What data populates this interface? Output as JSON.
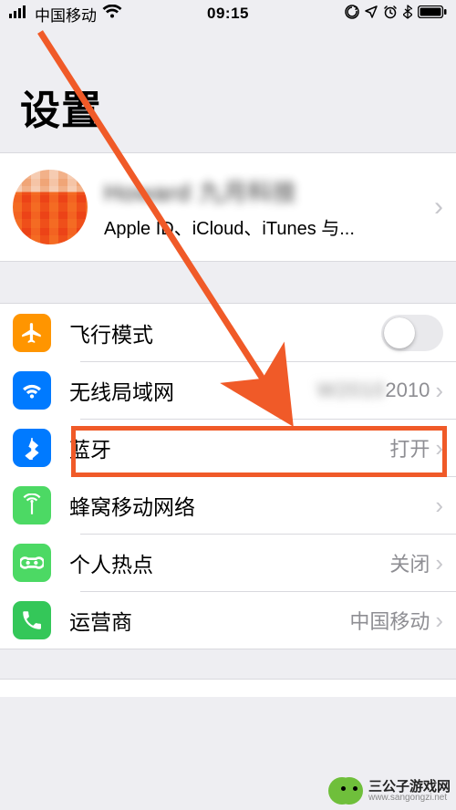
{
  "status": {
    "carrier": "中国移动",
    "time": "09:15"
  },
  "title": "设置",
  "profile": {
    "name": "Howard 九月科技",
    "sub": "Apple ID、iCloud、iTunes 与..."
  },
  "rows": {
    "airplane": {
      "label": "飞行模式"
    },
    "wifi": {
      "label": "无线局域网",
      "value_blur": "W2010",
      "value": "2010"
    },
    "bluetooth": {
      "label": "蓝牙",
      "value": "打开"
    },
    "cellular": {
      "label": "蜂窝移动网络"
    },
    "hotspot": {
      "label": "个人热点",
      "value": "关闭"
    },
    "carrier": {
      "label": "运营商",
      "value": "中国移动"
    }
  },
  "watermark": {
    "title": "三公子游戏网",
    "url": "www.sangongzi.net"
  }
}
